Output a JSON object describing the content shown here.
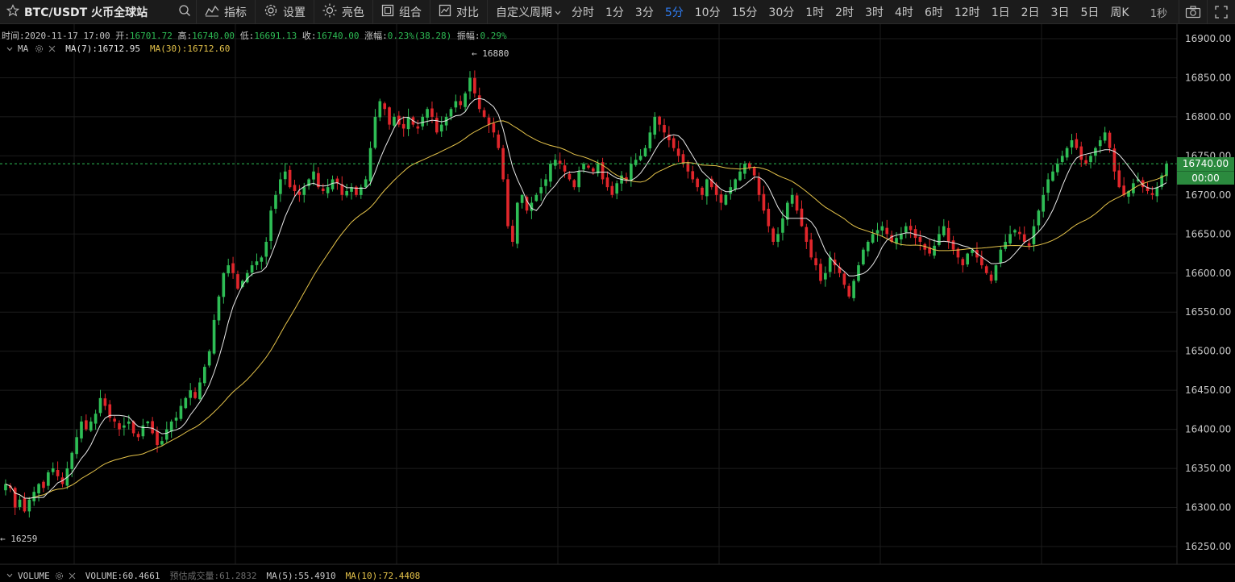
{
  "toolbar": {
    "symbol": "BTC/USDT 火币全球站",
    "buttons": {
      "indicators": "指标",
      "settings": "设置",
      "brightness": "亮色",
      "combination": "组合",
      "compare": "对比"
    },
    "custom_period": "自定义周期",
    "periods": [
      {
        "label": "分时",
        "active": false
      },
      {
        "label": "1分",
        "active": false
      },
      {
        "label": "3分",
        "active": false
      },
      {
        "label": "5分",
        "active": true
      },
      {
        "label": "10分",
        "active": false
      },
      {
        "label": "15分",
        "active": false
      },
      {
        "label": "30分",
        "active": false
      },
      {
        "label": "1时",
        "active": false
      },
      {
        "label": "2时",
        "active": false
      },
      {
        "label": "3时",
        "active": false
      },
      {
        "label": "4时",
        "active": false
      },
      {
        "label": "6时",
        "active": false
      },
      {
        "label": "12时",
        "active": false
      },
      {
        "label": "1日",
        "active": false
      },
      {
        "label": "2日",
        "active": false
      },
      {
        "label": "3日",
        "active": false
      },
      {
        "label": "5日",
        "active": false
      },
      {
        "label": "周K",
        "active": false
      }
    ],
    "refresh_label": "1秒"
  },
  "info": {
    "time_label": "时间:",
    "time": "2020-11-17 17:00",
    "open_label": "开:",
    "open": "16701.72",
    "high_label": "高:",
    "high": "16740.00",
    "low_label": "低:",
    "low": "16691.13",
    "close_label": "收:",
    "close": "16740.00",
    "change_label": "涨幅:",
    "change": "0.23%(38.28)",
    "amplitude_label": "振幅:",
    "amplitude": "0.29%"
  },
  "ma": {
    "name": "MA",
    "ma7_label": "MA(7):",
    "ma7": "16712.95",
    "ma30_label": "MA(30):",
    "ma30": "16712.60"
  },
  "volume": {
    "name": "VOLUME",
    "volume_label": "VOLUME:",
    "volume": "60.4661",
    "est_label": "预估成交量:",
    "est": "61.2832",
    "ma5_label": "MA(5):",
    "ma5": "55.4910",
    "ma10_label": "MA(10):",
    "ma10": "72.4408"
  },
  "price_tag": {
    "price": "16740.00",
    "countdown": "00:00"
  },
  "annotations": {
    "high_mark": "← 16880",
    "low_mark": "← 16259"
  },
  "colors": {
    "up": "#2ebd55",
    "down": "#e0262b",
    "ma7": "#e8e8e8",
    "ma30": "#e5c34a",
    "accent": "#2f7ef6"
  },
  "chart_data": {
    "type": "candlestick",
    "y_ticks": [
      16900,
      16850,
      16800,
      16750,
      16700,
      16650,
      16600,
      16550,
      16500,
      16450,
      16400,
      16350,
      16300,
      16250
    ],
    "y_tick_labels": [
      "16900.00",
      "16850.00",
      "16800.00",
      "16750.00",
      "16700.00",
      "16650.00",
      "16600.00",
      "16550.00",
      "16500.00",
      "16450.00",
      "16400.00",
      "16350.00",
      "16300.00",
      "16250.00"
    ],
    "ylim": [
      16230,
      16915
    ],
    "current_price": 16740.0,
    "high_marker": 16880,
    "low_marker": 16259,
    "closes": [
      16330,
      16325,
      16300,
      16310,
      16295,
      16310,
      16320,
      16330,
      16325,
      16345,
      16350,
      16340,
      16330,
      16350,
      16370,
      16390,
      16410,
      16400,
      16410,
      16420,
      16440,
      16430,
      16415,
      16410,
      16400,
      16405,
      16410,
      16395,
      16390,
      16405,
      16410,
      16395,
      16380,
      16385,
      16400,
      16410,
      16415,
      16430,
      16440,
      16450,
      16440,
      16460,
      16480,
      16500,
      16540,
      16570,
      16600,
      16610,
      16600,
      16580,
      16590,
      16600,
      16610,
      16615,
      16620,
      16640,
      16680,
      16700,
      16720,
      16730,
      16710,
      16705,
      16700,
      16710,
      16720,
      16730,
      16710,
      16705,
      16710,
      16720,
      16715,
      16700,
      16705,
      16710,
      16700,
      16710,
      16720,
      16760,
      16800,
      16820,
      16810,
      16790,
      16800,
      16790,
      16785,
      16800,
      16790,
      16785,
      16800,
      16810,
      16800,
      16780,
      16790,
      16800,
      16810,
      16820,
      16815,
      16830,
      16850,
      16830,
      16810,
      16800,
      16790,
      16780,
      16760,
      16720,
      16660,
      16640,
      16690,
      16700,
      16680,
      16690,
      16700,
      16710,
      16720,
      16740,
      16745,
      16740,
      16730,
      16720,
      16710,
      16730,
      16740,
      16735,
      16730,
      16740,
      16720,
      16710,
      16700,
      16715,
      16725,
      16720,
      16740,
      16745,
      16750,
      16760,
      16780,
      16800,
      16790,
      16780,
      16770,
      16760,
      16750,
      16740,
      16730,
      16720,
      16710,
      16700,
      16720,
      16710,
      16700,
      16690,
      16700,
      16710,
      16720,
      16730,
      16740,
      16735,
      16725,
      16700,
      16680,
      16660,
      16640,
      16650,
      16670,
      16690,
      16700,
      16680,
      16660,
      16640,
      16620,
      16610,
      16590,
      16600,
      16620,
      16610,
      16600,
      16585,
      16570,
      16590,
      16610,
      16630,
      16640,
      16650,
      16655,
      16660,
      16650,
      16640,
      16645,
      16650,
      16660,
      16655,
      16645,
      16640,
      16630,
      16625,
      16635,
      16650,
      16660,
      16640,
      16630,
      16620,
      16610,
      16625,
      16630,
      16620,
      16610,
      16600,
      16590,
      16610,
      16630,
      16640,
      16650,
      16655,
      16650,
      16640,
      16635,
      16660,
      16680,
      16700,
      16720,
      16730,
      16740,
      16750,
      16760,
      16770,
      16760,
      16745,
      16740,
      16750,
      16760,
      16770,
      16780,
      16760,
      16730,
      16710,
      16700,
      16705,
      16715,
      16720,
      16710,
      16705,
      16700,
      16710,
      16725,
      16740
    ]
  }
}
